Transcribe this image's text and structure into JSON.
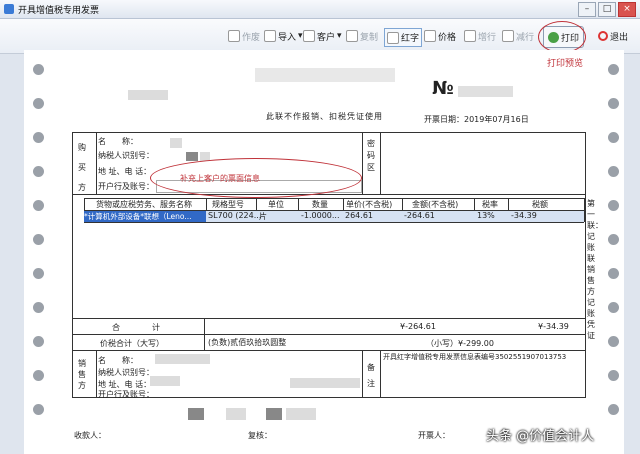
{
  "window": {
    "title": "开具增值税专用发票"
  },
  "toolbar": {
    "cancel": "作废",
    "copy": "复制",
    "import": "导入",
    "customer": "客户",
    "red": "红字",
    "price": "价格",
    "add_row": "增行",
    "del_row": "减行",
    "print": "打印",
    "exit": "退出",
    "print_preview": "打印预览"
  },
  "invoice": {
    "no_symbol": "№",
    "notice": "此联不作报销、扣税凭证使用",
    "date": "开票日期：2019年07月16日",
    "buyer_label": "购买方",
    "name_label": "名　　称：",
    "taxid_label": "纳税人识别号：",
    "addr_label": "地 址、电 话：",
    "bank_label": "开户行及账号：",
    "secret_label": "密码区",
    "buyer_note": "补充上客户的票面信息",
    "headers": [
      "货物或应税劳务、服务名称",
      "规格型号",
      "单位",
      "数量",
      "单价(不含税)",
      "金额(不含税)",
      "税率",
      "税额"
    ],
    "item": {
      "name": "*计算机外部设备*联想（Leno...",
      "spec": "SL700 (224...",
      "unit": "片",
      "qty": "-1.0000...",
      "price": "264.61",
      "amount": "-264.61",
      "rate": "13%",
      "tax": "-34.39"
    },
    "total_label": "合　　　计",
    "total_amount": "¥-264.61",
    "total_tax": "¥-34.39",
    "sum_label": "价税合计（大写）",
    "sum_upper": "(负数)贰佰玖拾玖圆整",
    "sum_lower": "（小写）¥-299.00",
    "seller_label": "销售方",
    "remark_label": "备注",
    "remark": "开具红字增值税专用发票信息表编号3502551907013753",
    "payee": "收款人：",
    "reviewer": "复核：",
    "issuer": "开票人：",
    "side_text": "第一联：记账联 销售方记账凭证"
  },
  "watermark": "头条 @价值会计人"
}
